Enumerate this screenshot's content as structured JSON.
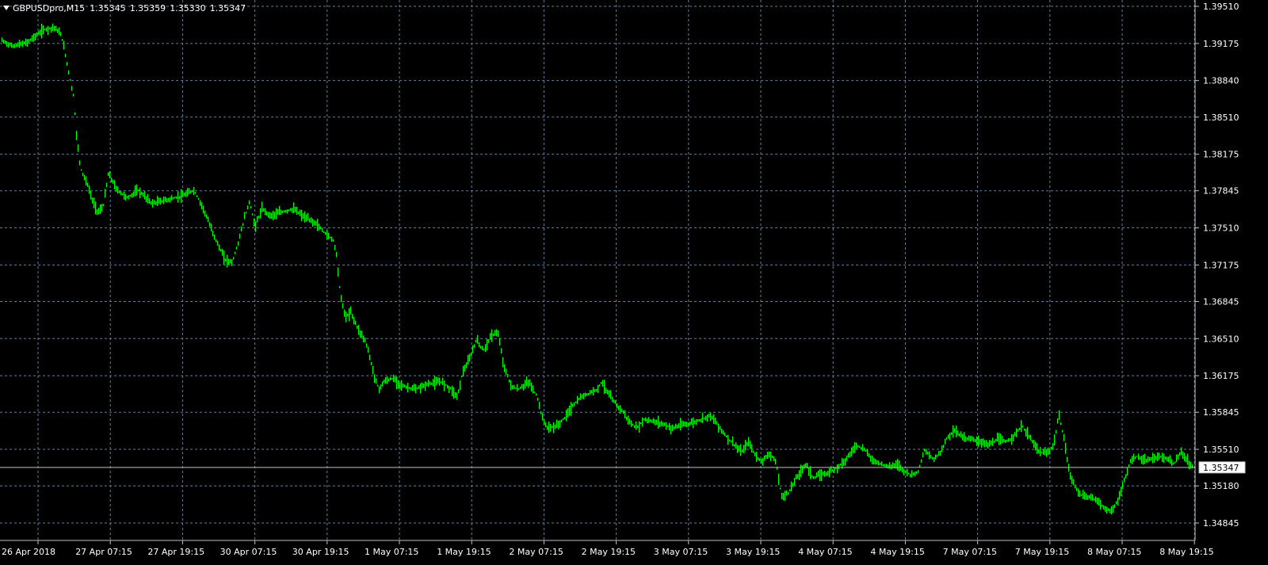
{
  "header": {
    "symbol_timeframe": "GBPUSDpro,M15",
    "open": "1.35345",
    "high": "1.35359",
    "low": "1.35330",
    "close": "1.35347"
  },
  "colors": {
    "background": "#000000",
    "grid": "#5f7f9a",
    "axis": "#c0c0c0",
    "text": "#ffffff",
    "series": "#00ff00",
    "bid_line": "#c0c0c0"
  },
  "icons": {
    "dropdown": "triangle-down-icon"
  },
  "chart_data": {
    "type": "line",
    "style": "bar-ohlc",
    "symbol": "GBPUSDpro",
    "timeframe": "M15",
    "grid": true,
    "price_axis_side": "right",
    "time_axis_side": "bottom",
    "ylim": [
      1.3476,
      1.3955
    ],
    "y_tick_labels": [
      "1.39510",
      "1.39175",
      "1.38840",
      "1.38510",
      "1.38175",
      "1.37845",
      "1.37510",
      "1.37175",
      "1.36845",
      "1.36510",
      "1.36175",
      "1.35845",
      "1.35510",
      "1.35180",
      "1.34845"
    ],
    "x_tick_labels": [
      "26 Apr 2018",
      "27 Apr 07:15",
      "27 Apr 19:15",
      "30 Apr 07:15",
      "30 Apr 19:15",
      "1 May 07:15",
      "1 May 19:15",
      "2 May 07:15",
      "2 May 19:15",
      "3 May 07:15",
      "3 May 19:15",
      "4 May 07:15",
      "4 May 19:15",
      "7 May 07:15",
      "7 May 19:15",
      "8 May 07:15",
      "8 May 19:15"
    ],
    "current_price": "1.35347",
    "series": [
      {
        "points": [
          [
            0,
            1.392
          ],
          [
            0.3,
            1.3915
          ],
          [
            0.7,
            1.3918
          ],
          [
            1.2,
            1.393
          ],
          [
            1.5,
            1.3932
          ],
          [
            1.7,
            1.3925
          ],
          [
            1.8,
            1.391
          ],
          [
            1.95,
            1.3885
          ],
          [
            2.05,
            1.387
          ],
          [
            2.15,
            1.383
          ],
          [
            2.25,
            1.3805
          ],
          [
            2.45,
            1.379
          ],
          [
            2.6,
            1.3775
          ],
          [
            2.75,
            1.3765
          ],
          [
            2.9,
            1.377
          ],
          [
            3.05,
            1.38
          ],
          [
            3.3,
            1.3785
          ],
          [
            3.6,
            1.3778
          ],
          [
            3.9,
            1.3785
          ],
          [
            4.3,
            1.3773
          ],
          [
            4.7,
            1.3776
          ],
          [
            5.2,
            1.378
          ],
          [
            5.5,
            1.3785
          ],
          [
            5.75,
            1.377
          ],
          [
            6.0,
            1.375
          ],
          [
            6.2,
            1.3735
          ],
          [
            6.4,
            1.3722
          ],
          [
            6.6,
            1.372
          ],
          [
            6.75,
            1.3735
          ],
          [
            6.95,
            1.376
          ],
          [
            7.1,
            1.3775
          ],
          [
            7.25,
            1.3752
          ],
          [
            7.45,
            1.3768
          ],
          [
            7.7,
            1.3762
          ],
          [
            8.0,
            1.3765
          ],
          [
            8.35,
            1.3768
          ],
          [
            8.7,
            1.376
          ],
          [
            9.0,
            1.3755
          ],
          [
            9.3,
            1.3745
          ],
          [
            9.5,
            1.374
          ],
          [
            9.6,
            1.3725
          ],
          [
            9.7,
            1.369
          ],
          [
            9.85,
            1.367
          ],
          [
            10.0,
            1.3675
          ],
          [
            10.2,
            1.366
          ],
          [
            10.4,
            1.365
          ],
          [
            10.5,
            1.364
          ],
          [
            10.65,
            1.362
          ],
          [
            10.8,
            1.3605
          ],
          [
            10.95,
            1.3612
          ],
          [
            11.2,
            1.3615
          ],
          [
            11.5,
            1.3608
          ],
          [
            11.85,
            1.3605
          ],
          [
            12.2,
            1.361
          ],
          [
            12.6,
            1.3612
          ],
          [
            12.9,
            1.3605
          ],
          [
            13.05,
            1.3598
          ],
          [
            13.2,
            1.362
          ],
          [
            13.4,
            1.3632
          ],
          [
            13.6,
            1.365
          ],
          [
            13.8,
            1.364
          ],
          [
            14.0,
            1.3652
          ],
          [
            14.2,
            1.3658
          ],
          [
            14.4,
            1.3625
          ],
          [
            14.6,
            1.3608
          ],
          [
            14.8,
            1.3605
          ],
          [
            15.1,
            1.3612
          ],
          [
            15.35,
            1.3598
          ],
          [
            15.5,
            1.3578
          ],
          [
            15.65,
            1.357
          ],
          [
            15.9,
            1.3572
          ],
          [
            16.15,
            1.358
          ],
          [
            16.35,
            1.359
          ],
          [
            16.6,
            1.3598
          ],
          [
            16.85,
            1.3602
          ],
          [
            17.05,
            1.3605
          ],
          [
            17.2,
            1.3612
          ],
          [
            17.4,
            1.36
          ],
          [
            17.6,
            1.3592
          ],
          [
            17.8,
            1.3585
          ],
          [
            18.0,
            1.3575
          ],
          [
            18.2,
            1.357
          ],
          [
            18.4,
            1.3578
          ],
          [
            18.7,
            1.3576
          ],
          [
            18.95,
            1.3574
          ],
          [
            19.2,
            1.357
          ],
          [
            19.5,
            1.3573
          ],
          [
            19.8,
            1.3575
          ],
          [
            20.05,
            1.3578
          ],
          [
            20.3,
            1.3582
          ],
          [
            20.55,
            1.3572
          ],
          [
            20.75,
            1.3563
          ],
          [
            21.0,
            1.3555
          ],
          [
            21.2,
            1.3548
          ],
          [
            21.4,
            1.3558
          ],
          [
            21.6,
            1.3545
          ],
          [
            21.8,
            1.354
          ],
          [
            22.0,
            1.3548
          ],
          [
            22.2,
            1.3538
          ],
          [
            22.35,
            1.3508
          ],
          [
            22.55,
            1.3512
          ],
          [
            22.75,
            1.3524
          ],
          [
            23.05,
            1.3538
          ],
          [
            23.25,
            1.3525
          ],
          [
            23.45,
            1.3528
          ],
          [
            23.7,
            1.353
          ],
          [
            23.95,
            1.3535
          ],
          [
            24.2,
            1.3542
          ],
          [
            24.5,
            1.3555
          ],
          [
            24.75,
            1.355
          ],
          [
            25.0,
            1.354
          ],
          [
            25.2,
            1.3538
          ],
          [
            25.45,
            1.3535
          ],
          [
            25.65,
            1.3538
          ],
          [
            25.85,
            1.3532
          ],
          [
            26.05,
            1.3528
          ],
          [
            26.25,
            1.353
          ],
          [
            26.45,
            1.355
          ],
          [
            26.7,
            1.3542
          ],
          [
            26.9,
            1.3548
          ],
          [
            27.1,
            1.3562
          ],
          [
            27.3,
            1.3568
          ],
          [
            27.55,
            1.3562
          ],
          [
            27.8,
            1.356
          ],
          [
            28.05,
            1.3558
          ],
          [
            28.3,
            1.3555
          ],
          [
            28.55,
            1.356
          ],
          [
            28.8,
            1.3558
          ],
          [
            29.0,
            1.3563
          ],
          [
            29.25,
            1.3572
          ],
          [
            29.5,
            1.356
          ],
          [
            29.75,
            1.3548
          ],
          [
            30.0,
            1.3548
          ],
          [
            30.15,
            1.3555
          ],
          [
            30.3,
            1.3582
          ],
          [
            30.45,
            1.356
          ],
          [
            30.6,
            1.353
          ],
          [
            30.8,
            1.3515
          ],
          [
            31.0,
            1.3508
          ],
          [
            31.2,
            1.3508
          ],
          [
            31.4,
            1.3505
          ],
          [
            31.6,
            1.3498
          ],
          [
            31.8,
            1.3495
          ],
          [
            32.0,
            1.3505
          ],
          [
            32.2,
            1.3525
          ],
          [
            32.35,
            1.354
          ],
          [
            32.55,
            1.3545
          ],
          [
            32.75,
            1.354
          ],
          [
            32.95,
            1.3542
          ],
          [
            33.15,
            1.3545
          ],
          [
            33.4,
            1.3542
          ],
          [
            33.6,
            1.3538
          ],
          [
            33.8,
            1.3548
          ],
          [
            34.0,
            1.354
          ],
          [
            34.15,
            1.35347
          ]
        ]
      }
    ]
  }
}
